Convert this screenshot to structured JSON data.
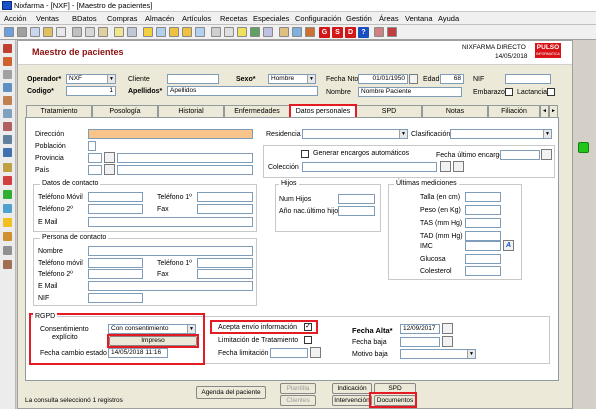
{
  "window_title": "Nixfarma - [NXF] - [Maestro de pacientes]",
  "menu": [
    "Acción",
    "Ventas",
    "BDatos",
    "Compras",
    "Almacén",
    "Artículos",
    "Recetas",
    "Especiales",
    "Configuración",
    "Gestión",
    "Áreas",
    "Ventana",
    "Ayuda"
  ],
  "toolbar_text_icons": [
    "G",
    "S",
    "D",
    "?"
  ],
  "header": {
    "title": "Maestro de pacientes",
    "brand": "NIXFARMA DIRECTO",
    "date": "14/05/2018",
    "logo_text": "PULSO",
    "logo_sub": "INFORMATICA"
  },
  "top_fields": {
    "operador_label": "Operador*",
    "operador_value": "NXF",
    "codigo_label": "Codigo*",
    "codigo_value": "1",
    "cliente_label": "Cliente",
    "apellidos_label": "Apellidos*",
    "apellidos_value": "Apellidos",
    "sexo_label": "Sexo*",
    "sexo_value": "Hombre",
    "fecha_nto_label": "Fecha Nto",
    "fecha_nto_value": "01/01/1950",
    "edad_label": "Edad",
    "edad_value": "68",
    "nif_label": "NIF",
    "nombre_label": "Nombre",
    "nombre_value": "Nombre Paciente",
    "embarazo_label": "Embarazo",
    "lactancia_label": "Lactancia"
  },
  "tabs": [
    "Tratamiento",
    "Posología",
    "Historial",
    "Enfermedades",
    "Datos personales",
    "SPD",
    "Notas",
    "Filiación"
  ],
  "tab_scroll": [
    "◄",
    "►"
  ],
  "address": {
    "direccion": "Dirección",
    "poblacion": "Población",
    "provincia": "Provincia",
    "pais": "País",
    "residencia": "Residencia",
    "clasificacion": "Clasificación",
    "generar": "Generar encargos automáticos",
    "fecha_ultimo_encargo": "Fecha último encargo",
    "coleccion": "Colección"
  },
  "contacto": {
    "title": "Datos de contacto",
    "telefono_movil": "Teléfono Móvil",
    "telefono1": "Teléfono 1º",
    "telefono2": "Teléfono 2º",
    "fax": "Fax",
    "email": "E Mail"
  },
  "hijos": {
    "title": "Hijos",
    "num_hijos": "Num Hijos",
    "anio_nac": "Año nac.último hijo"
  },
  "mediciones": {
    "title": "Últimas mediciones",
    "talla": "Talla (en cm)",
    "peso": "Peso (en Kg)",
    "tas": "TAS (mm Hg)",
    "tad": "TAD (mm Hg)",
    "imc": "IMC",
    "imc_icon": "A",
    "glucosa": "Glucosa",
    "colesterol": "Colesterol"
  },
  "persona_contacto": {
    "title": "Persona de contacto",
    "nombre": "Nombre",
    "telefono_movil": "Teléfono móvil",
    "telefono1": "Teléfono 1º",
    "telefono2": "Teléfono 2º",
    "fax": "Fax",
    "email": "E Mail",
    "nif": "NIF"
  },
  "rgpd": {
    "title": "RGPD",
    "consentimiento_label_1": "Consentimiento",
    "consentimiento_label_2": "explícito",
    "consentimiento_value": "Con consentimiento",
    "impreso_button": "Impreso",
    "fecha_cambio_label": "Fecha cambio estado",
    "fecha_cambio_value": "14/05/2018 11:16",
    "acepta_envio": "Acepta envío información",
    "limitacion": "Limitación de Tratamiento",
    "fecha_limitacion": "Fecha limitación",
    "fecha_alta_label": "Fecha Alta*",
    "fecha_alta_value": "12/09/2017",
    "fecha_baja": "Fecha baja",
    "motivo_baja": "Motivo baja"
  },
  "bottom_buttons": {
    "agenda": "Agenda del paciente",
    "plantilla": "Plantilla",
    "clientes": "Clientes",
    "indicacion": "Indicación",
    "spd": "SPD",
    "intervencion": "Intervención",
    "documentos": "Documentos"
  },
  "status_text": "La consulta seleccionó 1 registros",
  "colors": {
    "accent_red": "#e41b23",
    "title_red": "#8b1010",
    "orange_field": "#f9c48b",
    "green_indicator": "#22c51a"
  }
}
